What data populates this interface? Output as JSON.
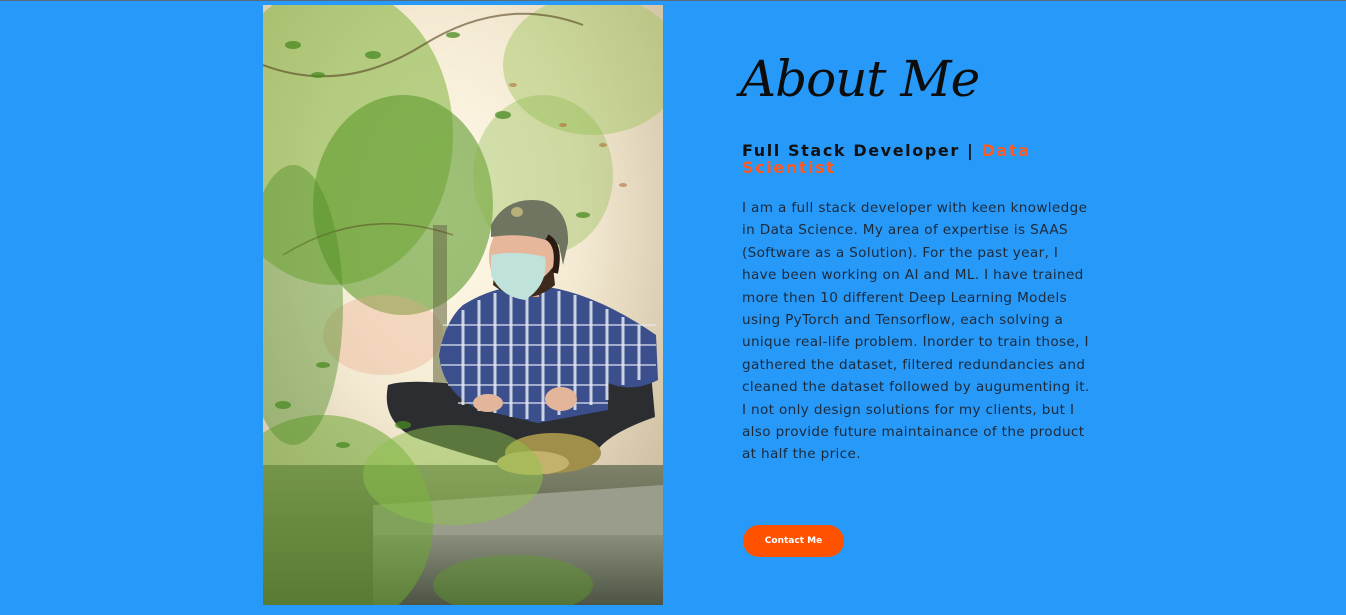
{
  "about": {
    "title": "About Me",
    "role_primary": "Full Stack Developer |",
    "role_accent": "Data Scientist",
    "bio": "I am a full stack developer with keen knowledge in Data Science. My area of expertise is SAAS (Software as a Solution). For the past year, I have been working on AI and ML. I have trained more then 10 different Deep Learning Models using PyTorch and Tensorflow, each solving a unique real-life problem. Inorder to train those, I gathered the dataset, filtered redundancies and cleaned the dataset followed by augumenting it. I not only design solutions for my clients, but I also provide future maintainance of the product at half the price.",
    "contact_button": "Contact Me"
  },
  "colors": {
    "background": "#2799f8",
    "accent": "#ff5a1f",
    "button": "#ff5200",
    "title": "#0d0d0d",
    "body_text": "#1d2a3a"
  }
}
